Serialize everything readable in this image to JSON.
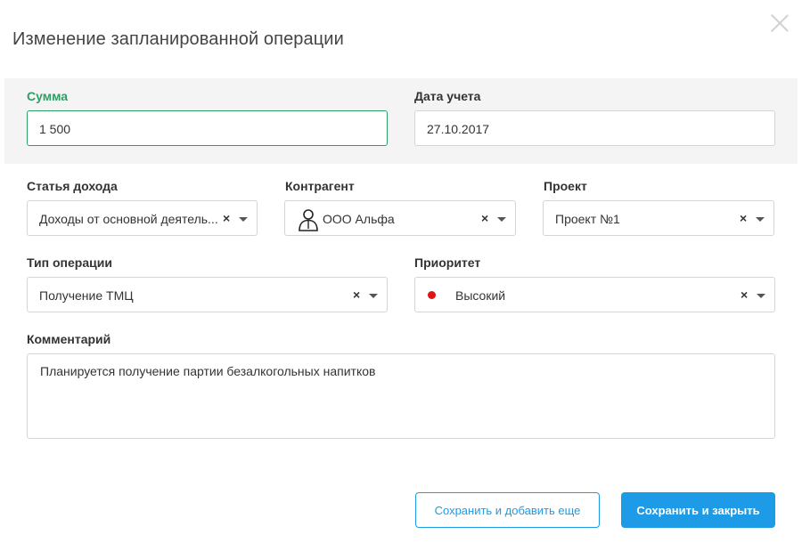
{
  "dialog": {
    "title": "Изменение запланированной операции"
  },
  "fields": {
    "amount": {
      "label": "Сумма",
      "value": "1 500"
    },
    "date": {
      "label": "Дата учета",
      "value": "27.10.2017"
    },
    "income_item": {
      "label": "Статья дохода",
      "value": "Доходы от основной деятель...",
      "clear": "×"
    },
    "counterparty": {
      "label": "Контрагент",
      "value": "ООО Альфа",
      "clear": "×"
    },
    "project": {
      "label": "Проект",
      "value": "Проект №1",
      "clear": "×"
    },
    "operation_type": {
      "label": "Тип операции",
      "value": "Получение ТМЦ",
      "clear": "×"
    },
    "priority": {
      "label": "Приоритет",
      "value": "Высокий",
      "clear": "×",
      "color": "#e01414"
    },
    "comment": {
      "label": "Комментарий",
      "value": "Планируется получение партии безалкогольных напитков"
    }
  },
  "buttons": {
    "save_and_add": "Сохранить и добавить еще",
    "save_and_close": "Сохранить и закрыть"
  },
  "colors": {
    "accent_green": "#2e9e63",
    "primary_blue": "#1e9be6",
    "band_gray": "#f4f4f4"
  },
  "icons": [
    "close-icon",
    "person-icon",
    "clear-icon",
    "chevron-down-icon",
    "priority-dot-icon"
  ]
}
